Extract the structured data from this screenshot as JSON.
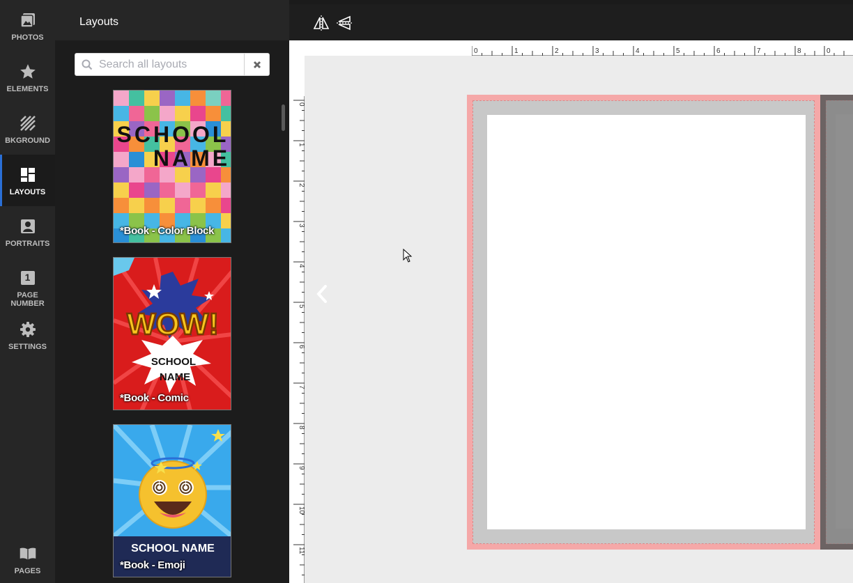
{
  "rail": {
    "items": [
      {
        "label": "PHOTOS",
        "icon": "photos-icon"
      },
      {
        "label": "ELEMENTS",
        "icon": "star-icon"
      },
      {
        "label": "BKGROUND",
        "icon": "background-icon"
      },
      {
        "label": "LAYOUTS",
        "icon": "layouts-icon",
        "active": true
      },
      {
        "label": "PORTRAITS",
        "icon": "portrait-icon"
      },
      {
        "label": "PAGE\nNUMBER",
        "icon": "page-number-icon",
        "badge": "1"
      },
      {
        "label": "SETTINGS",
        "icon": "gear-icon"
      }
    ],
    "pages_label": "PAGES"
  },
  "panel": {
    "title": "Layouts",
    "search_placeholder": "Search all layouts",
    "layouts": [
      {
        "label": "*Book - Color Block",
        "art_text": [
          "SCHOOL",
          "NAME"
        ]
      },
      {
        "label": "*Book - Comic",
        "art_text": [
          "WOW!",
          "SCHOOL",
          "NAME"
        ]
      },
      {
        "label": "*Book - Emoji",
        "art_text": [
          "SCHOOL NAME"
        ]
      }
    ]
  },
  "rulers": {
    "horizontal": [
      "0",
      "1",
      "2",
      "3",
      "4",
      "5",
      "6",
      "7",
      "8",
      "0"
    ],
    "vertical": [
      "0",
      "1",
      "2",
      "3",
      "4",
      "5",
      "6",
      "7",
      "8",
      "9",
      "10",
      "11"
    ]
  },
  "colors": {
    "accent": "#2a6fd6",
    "bleed": "#f5a8a8",
    "canvas": "#ececec"
  }
}
